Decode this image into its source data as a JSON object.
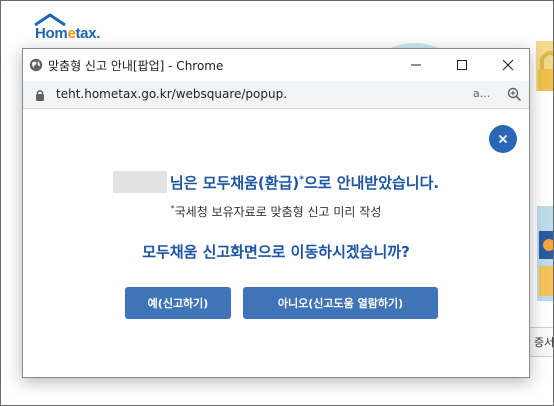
{
  "background": {
    "logo_text_pre": "Hom",
    "logo_text_hl": "e",
    "logo_text_post": "tax.",
    "partial_label": "증서"
  },
  "popup": {
    "window_title": "맞춤형 신고 안내[팝업] - Chrome",
    "url": "teht.hometax.go.kr/websquare/popup.",
    "translate_label": "a...",
    "main_text": "님은 모두채움(환급)",
    "main_text_mark": "*",
    "main_text_end": "으로 안내받았습니다.",
    "sub_mark": "*",
    "sub_text": "국세청 보유자료로 맞춤형 신고 미리 작성",
    "question": "모두채움 신고화면으로 이동하시겠습니까?",
    "yes_button": "예(신고하기)",
    "no_button": "아니오(신고도움 열람하기)"
  },
  "colors": {
    "brand_blue": "#1d55a4",
    "button_blue": "#3f74b8",
    "close_blue": "#2b67b6",
    "logo_orange": "#f39800"
  }
}
